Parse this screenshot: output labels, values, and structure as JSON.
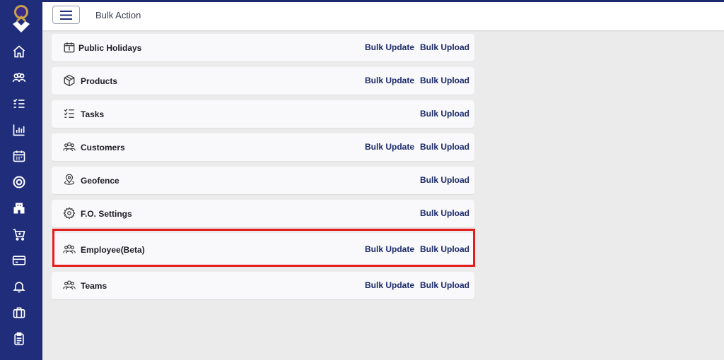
{
  "header": {
    "title": "Bulk Action"
  },
  "sidebar": {
    "items": [
      {
        "name": "home-icon"
      },
      {
        "name": "users-icon"
      },
      {
        "name": "tasks-icon"
      },
      {
        "name": "chart-icon"
      },
      {
        "name": "calendar-icon"
      },
      {
        "name": "target-icon"
      },
      {
        "name": "building-icon"
      },
      {
        "name": "cart-icon"
      },
      {
        "name": "card-icon"
      },
      {
        "name": "bell-icon"
      },
      {
        "name": "briefcase-icon"
      },
      {
        "name": "clipboard-icon"
      }
    ]
  },
  "rows": [
    {
      "label": "Public Holidays",
      "icon": "calendar-icon",
      "update": "Bulk Update",
      "upload": "Bulk Upload"
    },
    {
      "label": "Products",
      "icon": "box-icon",
      "update": "Bulk Update",
      "upload": "Bulk Upload"
    },
    {
      "label": "Tasks",
      "icon": "checklist-icon",
      "update": "",
      "upload": "Bulk Upload"
    },
    {
      "label": "Customers",
      "icon": "customers-icon",
      "update": "Bulk Update",
      "upload": "Bulk Upload"
    },
    {
      "label": "Geofence",
      "icon": "location-icon",
      "update": "",
      "upload": "Bulk Upload"
    },
    {
      "label": "F.O. Settings",
      "icon": "gear-icon",
      "update": "",
      "upload": "Bulk Upload"
    },
    {
      "label": "Employee(Beta)",
      "icon": "employees-icon",
      "update": "Bulk Update",
      "upload": "Bulk Upload"
    },
    {
      "label": "Teams",
      "icon": "teams-icon",
      "update": "Bulk Update",
      "upload": "Bulk Upload"
    }
  ],
  "colors": {
    "sidebar": "#1f2d7a",
    "accent": "#1c2b6b",
    "highlight": "#e31b1b"
  }
}
